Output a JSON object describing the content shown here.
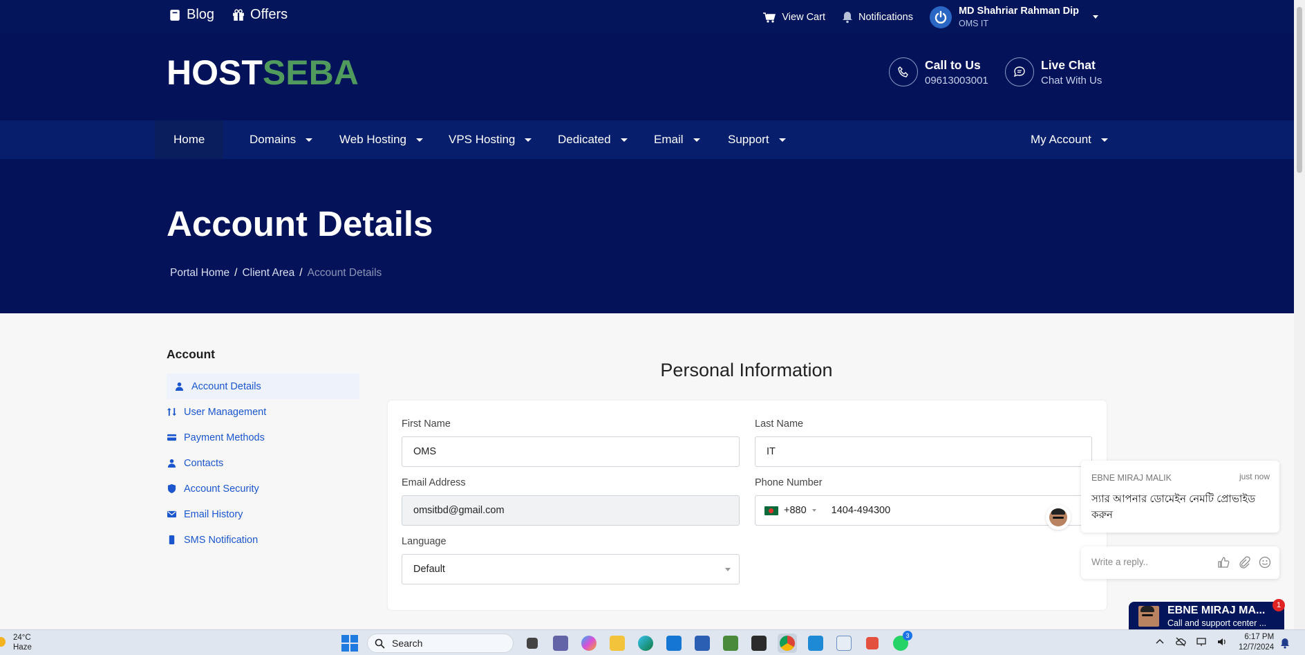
{
  "topbar": {
    "blog": "Blog",
    "offers": "Offers",
    "view_cart": "View Cart",
    "notifications": "Notifications",
    "user_name": "MD Shahriar Rahman Dip",
    "user_company": "OMS IT"
  },
  "header": {
    "logo_part1": "HOST",
    "logo_part2": "SEBA",
    "call_title": "Call to Us",
    "call_number": "09613003001",
    "chat_title": "Live Chat",
    "chat_sub": "Chat With Us"
  },
  "nav": {
    "home": "Home",
    "domains": "Domains",
    "web_hosting": "Web Hosting",
    "vps_hosting": "VPS Hosting",
    "dedicated": "Dedicated",
    "email": "Email",
    "support": "Support",
    "my_account": "My Account"
  },
  "hero": {
    "title": "Account Details",
    "breadcrumbs": [
      "Portal Home",
      "Client Area",
      "Account Details"
    ],
    "sep": "/"
  },
  "sidebar": {
    "title": "Account",
    "items": [
      {
        "label": "Account Details",
        "icon": "user-icon"
      },
      {
        "label": "User Management",
        "icon": "users-arrows-icon"
      },
      {
        "label": "Payment Methods",
        "icon": "credit-card-icon"
      },
      {
        "label": "Contacts",
        "icon": "contact-icon"
      },
      {
        "label": "Account Security",
        "icon": "shield-icon"
      },
      {
        "label": "Email History",
        "icon": "envelope-icon"
      },
      {
        "label": "SMS Notification",
        "icon": "mobile-icon"
      }
    ]
  },
  "form": {
    "section_title": "Personal Information",
    "first_name_label": "First Name",
    "first_name_value": "OMS",
    "last_name_label": "Last Name",
    "last_name_value": "IT",
    "email_label": "Email Address",
    "email_value": "omsitbd@gmail.com",
    "phone_label": "Phone Number",
    "phone_code": "+880",
    "phone_value": "1404-494300",
    "language_label": "Language",
    "language_value": "Default"
  },
  "chat": {
    "agent": "EBNE MIRAJ MALIK",
    "time": "just now",
    "message": "স্যার আপনার ডোমেইন নেমটি প্রোভাইড করুন",
    "reply_placeholder": "Write a reply..",
    "bar_name": "EBNE MIRAJ MA...",
    "bar_sub": "Call and support center ...",
    "badge": "1"
  },
  "taskbar": {
    "temp": "24°C",
    "weather": "Haze",
    "search": "Search",
    "whatsapp_badge": "3",
    "time": "6:17 PM",
    "date": "12/7/2024"
  },
  "colors": {
    "navy": "#04125a",
    "nav": "#061e6b",
    "link": "#1b56cf",
    "logo_green": "#4f9a5c"
  }
}
